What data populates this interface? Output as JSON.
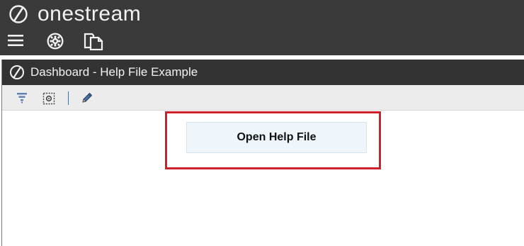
{
  "app": {
    "brand_name": "onestream",
    "logo_icon": "onestream-logo-icon"
  },
  "app_toolbar": {
    "icons": [
      "menu-icon",
      "global-settings-icon",
      "pages-icon"
    ]
  },
  "dashboard": {
    "title": "Dashboard - Help File Example",
    "toolbar_icons": [
      "filter-icon",
      "select-region-icon",
      "edit-pencil-icon"
    ],
    "button_label": "Open Help File"
  },
  "colors": {
    "app_bar": "#3a3a3a",
    "title_bar": "#333333",
    "toolbar": "#ececec",
    "button_bg": "#eef6fb",
    "highlight": "#d0202a"
  }
}
